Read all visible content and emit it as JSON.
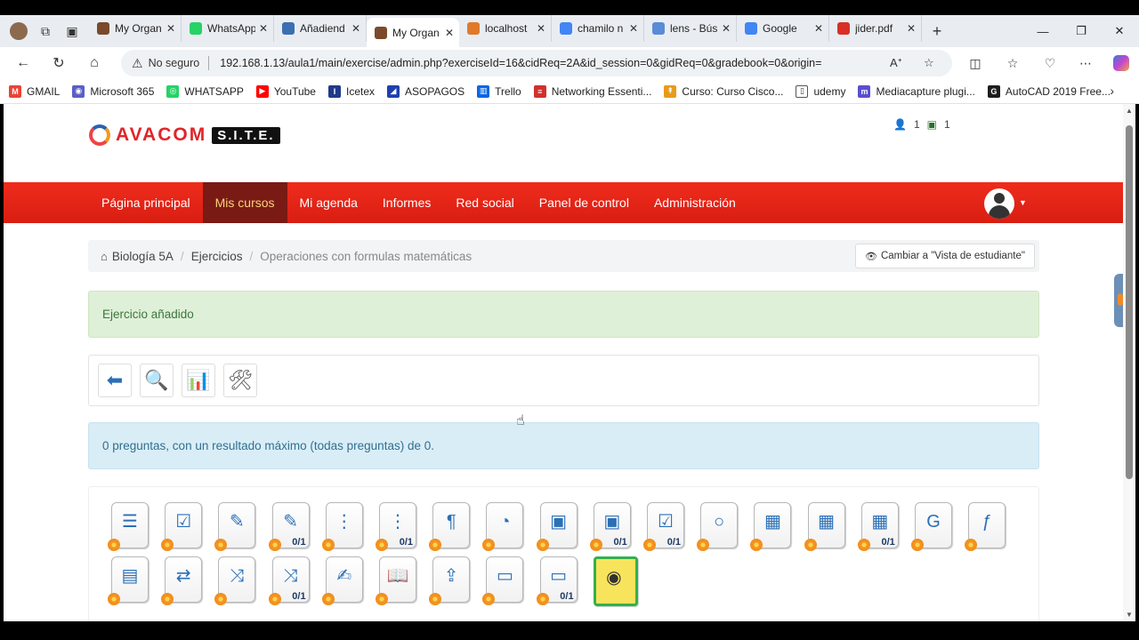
{
  "browser": {
    "tabs": [
      {
        "title": "My Organ",
        "color": "#7a4a2a",
        "active": false
      },
      {
        "title": "WhatsApp",
        "color": "#25d366",
        "active": false
      },
      {
        "title": "Añadiend",
        "color": "#3b6fb0",
        "active": false
      },
      {
        "title": "My Organ",
        "color": "#7a4a2a",
        "active": true
      },
      {
        "title": "localhost",
        "color": "#e07a2a",
        "active": false
      },
      {
        "title": "chamilo n",
        "color": "#4285f4",
        "active": false
      },
      {
        "title": "lens - Bús",
        "color": "#5b8bd6",
        "active": false
      },
      {
        "title": "Google",
        "color": "#4285f4",
        "active": false
      },
      {
        "title": "jider.pdf",
        "color": "#d93025",
        "active": false
      }
    ],
    "close_glyph": "✕",
    "new_tab": "+",
    "insecure_label": "No seguro",
    "url": "192.168.1.13/aula1/main/exercise/admin.php?exerciseId=16&cidReq=2A&id_session=0&gidReq=0&gradebook=0&origin=",
    "bookmarks": [
      {
        "label": "GMAIL",
        "color": "#ea4335",
        "glyph": "M"
      },
      {
        "label": "Microsoft 365",
        "color": "#5b5fc7",
        "glyph": "◉"
      },
      {
        "label": "WHATSAPP",
        "color": "#25d366",
        "glyph": "◎"
      },
      {
        "label": "YouTube",
        "color": "#ff0000",
        "glyph": "▶"
      },
      {
        "label": "Icetex",
        "color": "#1f3a8a",
        "glyph": "I"
      },
      {
        "label": "ASOPAGOS",
        "color": "#1e40af",
        "glyph": "◢"
      },
      {
        "label": "Trello",
        "color": "#0c66e4",
        "glyph": "▥"
      },
      {
        "label": "Networking Essenti...",
        "color": "#d0312d",
        "glyph": "≡"
      },
      {
        "label": "Curso: Curso Cisco...",
        "color": "#e79b1b",
        "glyph": "↟"
      },
      {
        "label": "udemy",
        "color": "#ffffff",
        "glyph": "▯"
      },
      {
        "label": "Mediacapture plugi...",
        "color": "#5a4fcf",
        "glyph": "m"
      },
      {
        "label": "AutoCAD 2019 Free...",
        "color": "#1d1d1d",
        "glyph": "G"
      }
    ]
  },
  "header": {
    "brand": "AVACOM",
    "brand_suffix": "S.I.T.E.",
    "counter_users": "1",
    "counter_courses": "1"
  },
  "nav": {
    "items": [
      "Página principal",
      "Mis cursos",
      "Mi agenda",
      "Informes",
      "Red social",
      "Panel de control",
      "Administración"
    ],
    "active_index": 1
  },
  "breadcrumb": {
    "course": "Biología 5A",
    "section": "Ejercicios",
    "current": "Operaciones con formulas matemáticas",
    "student_view_button": "Cambiar a \"Vista de estudiante\""
  },
  "alerts": {
    "success": "Ejercicio añadido",
    "info": "0 preguntas, con un resultado máximo (todas preguntas) de 0."
  },
  "toolbar": {
    "tools": [
      {
        "name": "back-icon",
        "glyph": "⬅",
        "color": "#2b6fb6"
      },
      {
        "name": "preview-icon",
        "glyph": "🔍",
        "color": "#2b6fb6"
      },
      {
        "name": "results-chart-icon",
        "glyph": "📊",
        "color": "#c0392b"
      },
      {
        "name": "settings-tools-icon",
        "glyph": "🛠",
        "color": "#555"
      }
    ]
  },
  "question_types": [
    {
      "name": "qt-multiple-choice",
      "glyph": "☰",
      "score": ""
    },
    {
      "name": "qt-multiple-answer",
      "glyph": "☑",
      "score": ""
    },
    {
      "name": "qt-fill-blanks",
      "glyph": "✎",
      "score": ""
    },
    {
      "name": "qt-fill-blanks-scored",
      "glyph": "✎",
      "score": "0/1"
    },
    {
      "name": "qt-matching",
      "glyph": "⋮",
      "score": ""
    },
    {
      "name": "qt-matching-scored",
      "glyph": "⋮",
      "score": "0/1"
    },
    {
      "name": "qt-open-answer",
      "glyph": "¶",
      "score": ""
    },
    {
      "name": "qt-oral-expression",
      "glyph": "◔",
      "score": ""
    },
    {
      "name": "qt-image-hotspot",
      "glyph": "▣",
      "score": ""
    },
    {
      "name": "qt-image-hotspot-scored",
      "glyph": "▣",
      "score": "0/1"
    },
    {
      "name": "qt-exact-selection",
      "glyph": "☑",
      "score": "0/1"
    },
    {
      "name": "qt-unique-answer-no-option",
      "glyph": "○",
      "score": ""
    },
    {
      "name": "qt-multiple-true-false",
      "glyph": "▦",
      "score": ""
    },
    {
      "name": "qt-degree-certainty",
      "glyph": "▦",
      "score": ""
    },
    {
      "name": "qt-combination-true-false",
      "glyph": "▦",
      "score": "0/1"
    },
    {
      "name": "qt-global-multiple-answer",
      "glyph": "G",
      "score": ""
    },
    {
      "name": "qt-calculated-answer",
      "glyph": "ƒ",
      "score": ""
    },
    {
      "name": "qt-annotation-images",
      "glyph": "▤",
      "score": ""
    },
    {
      "name": "qt-drag-drop",
      "glyph": "⇄",
      "score": ""
    },
    {
      "name": "qt-match-arrows",
      "glyph": "⤨",
      "score": ""
    },
    {
      "name": "qt-match-arrows-scored",
      "glyph": "⤨",
      "score": "0/1"
    },
    {
      "name": "qt-annotation",
      "glyph": "✍",
      "score": ""
    },
    {
      "name": "qt-reading-comprehension",
      "glyph": "📖",
      "score": ""
    },
    {
      "name": "qt-upload-answer",
      "glyph": "⇪",
      "score": ""
    },
    {
      "name": "qt-calendar-one",
      "glyph": "▭",
      "score": ""
    },
    {
      "name": "qt-calendar-scored",
      "glyph": "▭",
      "score": "0/1"
    },
    {
      "name": "qt-media-question",
      "glyph": "◉",
      "score": ""
    }
  ]
}
